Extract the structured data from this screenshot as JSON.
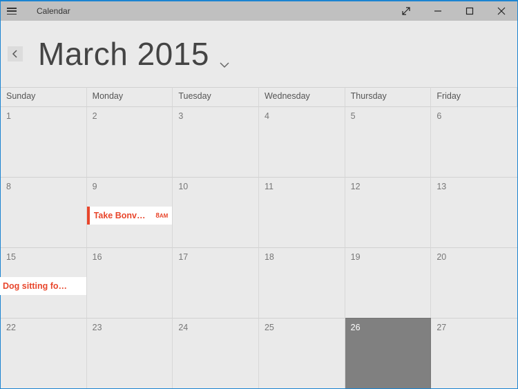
{
  "titlebar": {
    "app_name": "Calendar"
  },
  "header": {
    "month_label": "March 2015"
  },
  "colors": {
    "accent": "#e8462c",
    "window_border": "#1b84d1",
    "today_bg": "#808080"
  },
  "weekdays": [
    "Sunday",
    "Monday",
    "Tuesday",
    "Wednesday",
    "Thursday",
    "Friday"
  ],
  "cells": {
    "r0c0": "1",
    "r0c1": "2",
    "r0c2": "3",
    "r0c3": "4",
    "r0c4": "5",
    "r0c5": "6",
    "r1c0": "8",
    "r1c1": "9",
    "r1c2": "10",
    "r1c3": "11",
    "r1c4": "12",
    "r1c5": "13",
    "r2c0": "15",
    "r2c1": "16",
    "r2c2": "17",
    "r2c3": "18",
    "r2c4": "19",
    "r2c5": "20",
    "r3c0": "22",
    "r3c1": "23",
    "r3c2": "24",
    "r3c3": "25",
    "r3c4": "26",
    "r3c5": "27"
  },
  "events": {
    "mar9": {
      "title": "Take Bonv…",
      "time_num": "8",
      "time_ampm": "AM"
    },
    "mar15": {
      "title": "Dog sitting fo…"
    }
  }
}
